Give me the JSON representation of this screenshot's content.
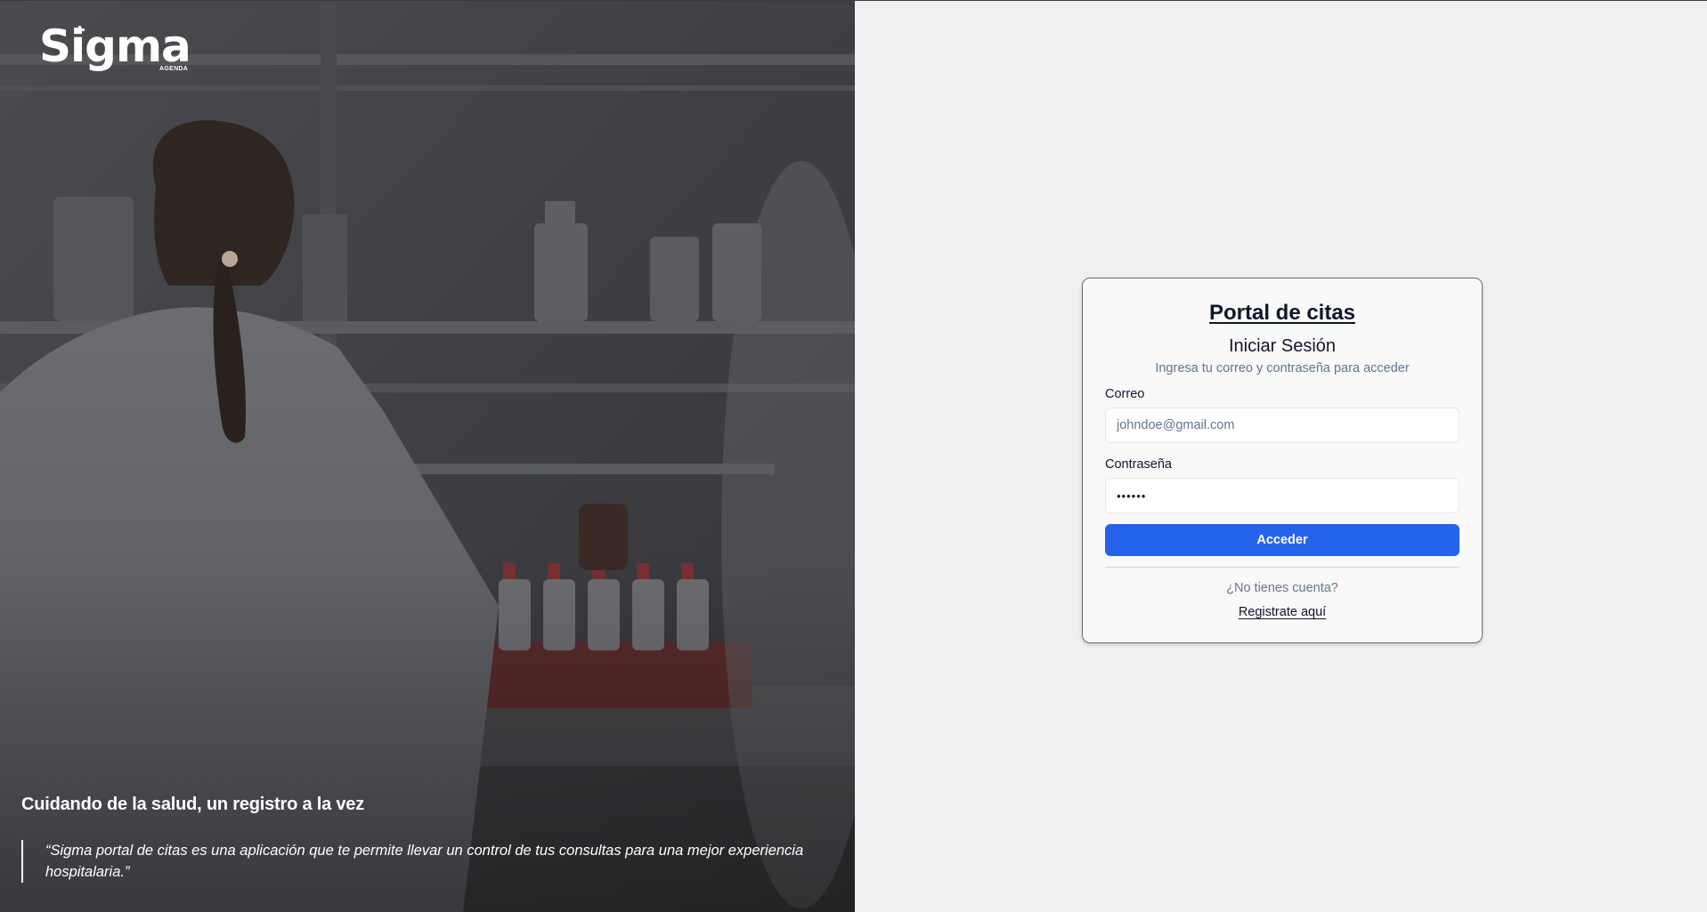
{
  "brand": {
    "logo_text": "Sigma",
    "logo_subtext": "AGENDA"
  },
  "hero": {
    "tagline": "Cuidando de la salud, un registro a la vez",
    "quote": "“Sigma portal de citas es una aplicación que te permite llevar un control de tus consultas para una mejor experiencia hospitalaria.”"
  },
  "login": {
    "title": "Portal de citas",
    "heading": "Iniciar Sesión",
    "subheading": "Ingresa tu correo y contraseña para acceder",
    "email_label": "Correo",
    "email_placeholder": "johndoe@gmail.com",
    "email_value": "",
    "password_label": "Contraseña",
    "password_value": "••••••",
    "submit_label": "Acceder",
    "no_account_text": "¿No tienes cuenta?",
    "register_link": "Registrate aquí"
  },
  "colors": {
    "primary": "#2563eb",
    "muted_text": "#64748b",
    "page_background": "#f0f0f2",
    "hero_overlay": "#3b3c3f"
  },
  "icons": [
    "sigma-logo"
  ]
}
